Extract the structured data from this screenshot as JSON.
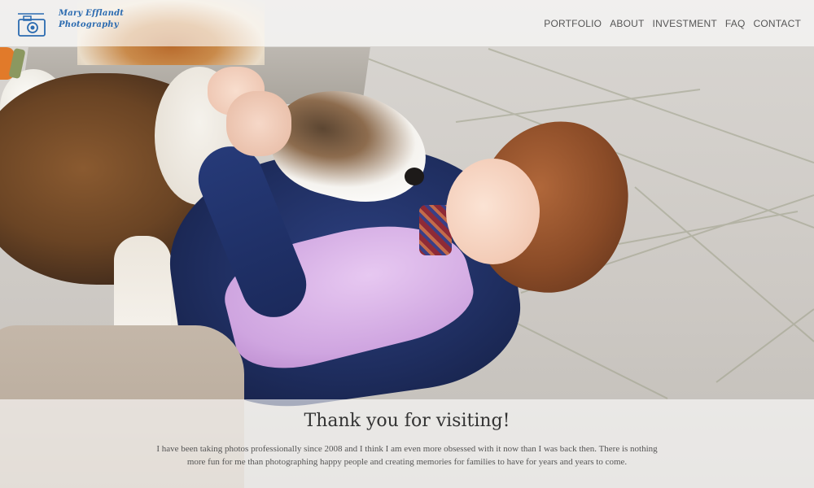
{
  "brand": {
    "name_line1": "Mary Efflandt",
    "name_line2": "Photography",
    "logo_icon": "camera-icon",
    "color": "#2b6bb0"
  },
  "nav": {
    "items": [
      {
        "label": "PORTFOLIO"
      },
      {
        "label": "ABOUT"
      },
      {
        "label": "INVESTMENT"
      },
      {
        "label": "FAQ"
      },
      {
        "label": "CONTACT"
      }
    ]
  },
  "hero": {
    "title": "Thank you for visiting!",
    "body": "I have been taking photos professionally since 2008 and I think I am even more obsessed with it now than I was back then. There is nothing more fun for me than photographing happy people and creating memories for families to have for years and years to come."
  }
}
